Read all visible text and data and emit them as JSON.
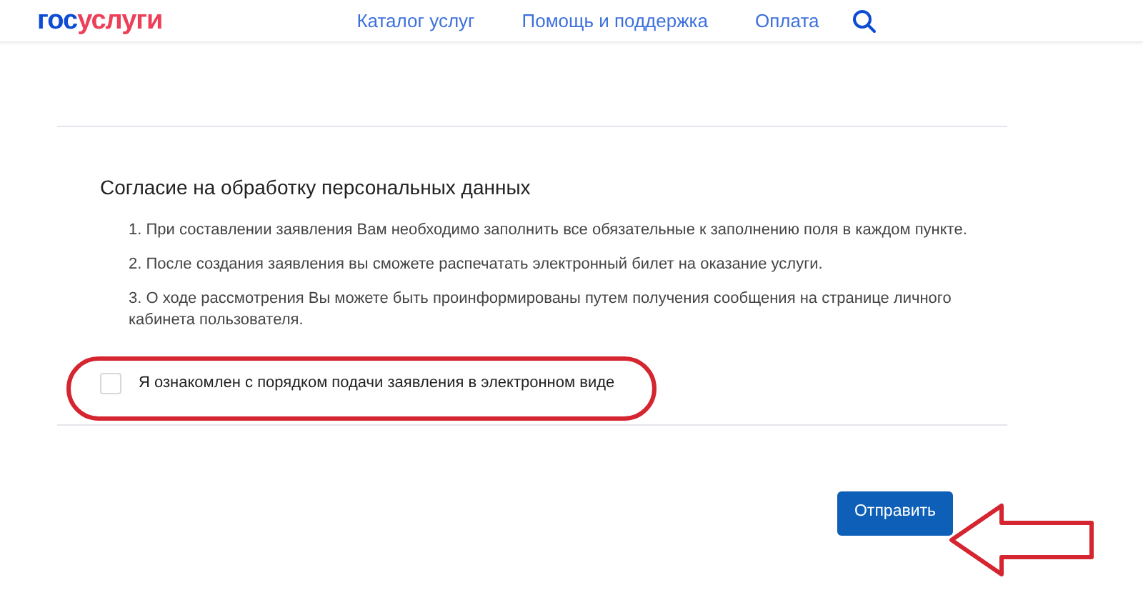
{
  "header": {
    "logo": [
      "гос",
      "услуги"
    ],
    "nav": [
      "Каталог услуг",
      "Помощь и поддержка",
      "Оплата"
    ]
  },
  "consent": {
    "title": "Согласие на обработку персональных данных",
    "items": [
      "1. При составлении заявления Вам необходимо заполнить все обязательные к заполнению поля в каждом пункте.",
      "2. После создания заявления вы сможете распечатать электронный билет на оказание услуги.",
      "3. О ходе рассмотрения Вы можете быть проинформированы путем получения сообщения на странице личного кабинета пользователя."
    ],
    "checkbox": {
      "label": "Я ознакомлен с порядком подачи заявления в электронном виде",
      "checked": false
    }
  },
  "submit_button": "Отправить"
}
